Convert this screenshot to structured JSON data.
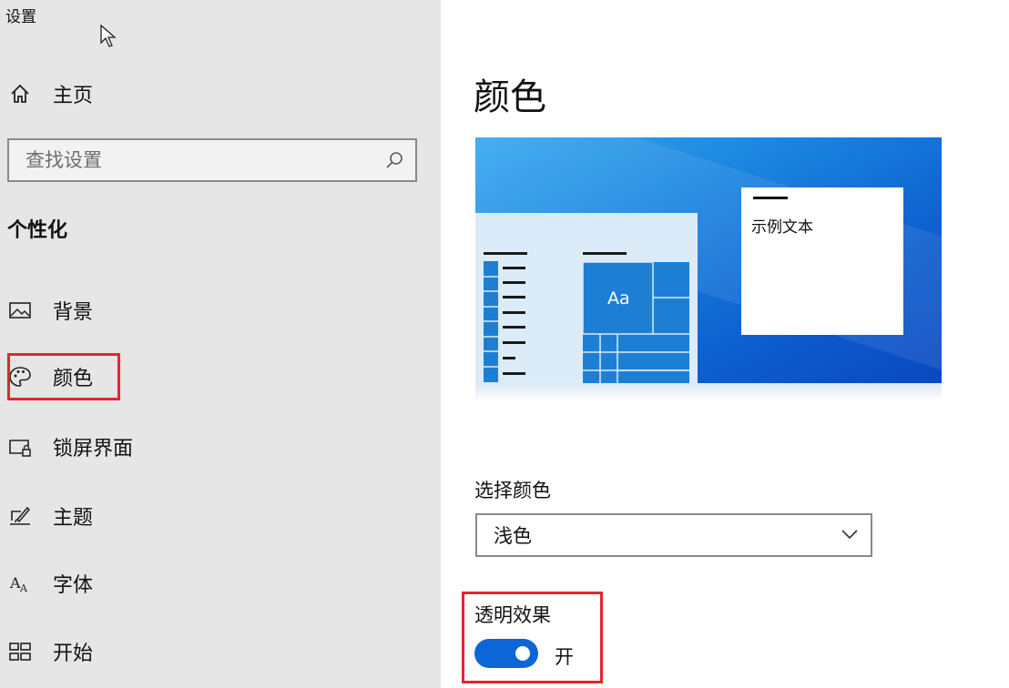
{
  "window": {
    "title": "设置"
  },
  "sidebar": {
    "home": {
      "label": "主页",
      "icon": "home-icon"
    },
    "search": {
      "placeholder": "查找设置",
      "icon": "search-icon"
    },
    "section_title": "个性化",
    "items": [
      {
        "label": "背景",
        "icon": "picture-icon"
      },
      {
        "label": "颜色",
        "icon": "palette-icon",
        "selected": true,
        "highlighted": true
      },
      {
        "label": "锁屏界面",
        "icon": "lock-screen-icon"
      },
      {
        "label": "主题",
        "icon": "theme-brush-icon"
      },
      {
        "label": "字体",
        "icon": "font-icon"
      },
      {
        "label": "开始",
        "icon": "start-tiles-icon"
      }
    ]
  },
  "main": {
    "title": "颜色",
    "preview": {
      "sample_text": "示例文本",
      "tile_text": "Aa"
    },
    "choose_color": {
      "label": "选择颜色",
      "value": "浅色",
      "icon": "chevron-down-icon"
    },
    "transparency": {
      "label": "透明效果",
      "state": "开",
      "on": true,
      "highlighted": true
    }
  },
  "colors": {
    "accent": "#0c66d6",
    "sidebar_bg": "#e6e6e6",
    "highlight_box": "#e3262d",
    "preview_tile": "#1d7fd4"
  }
}
